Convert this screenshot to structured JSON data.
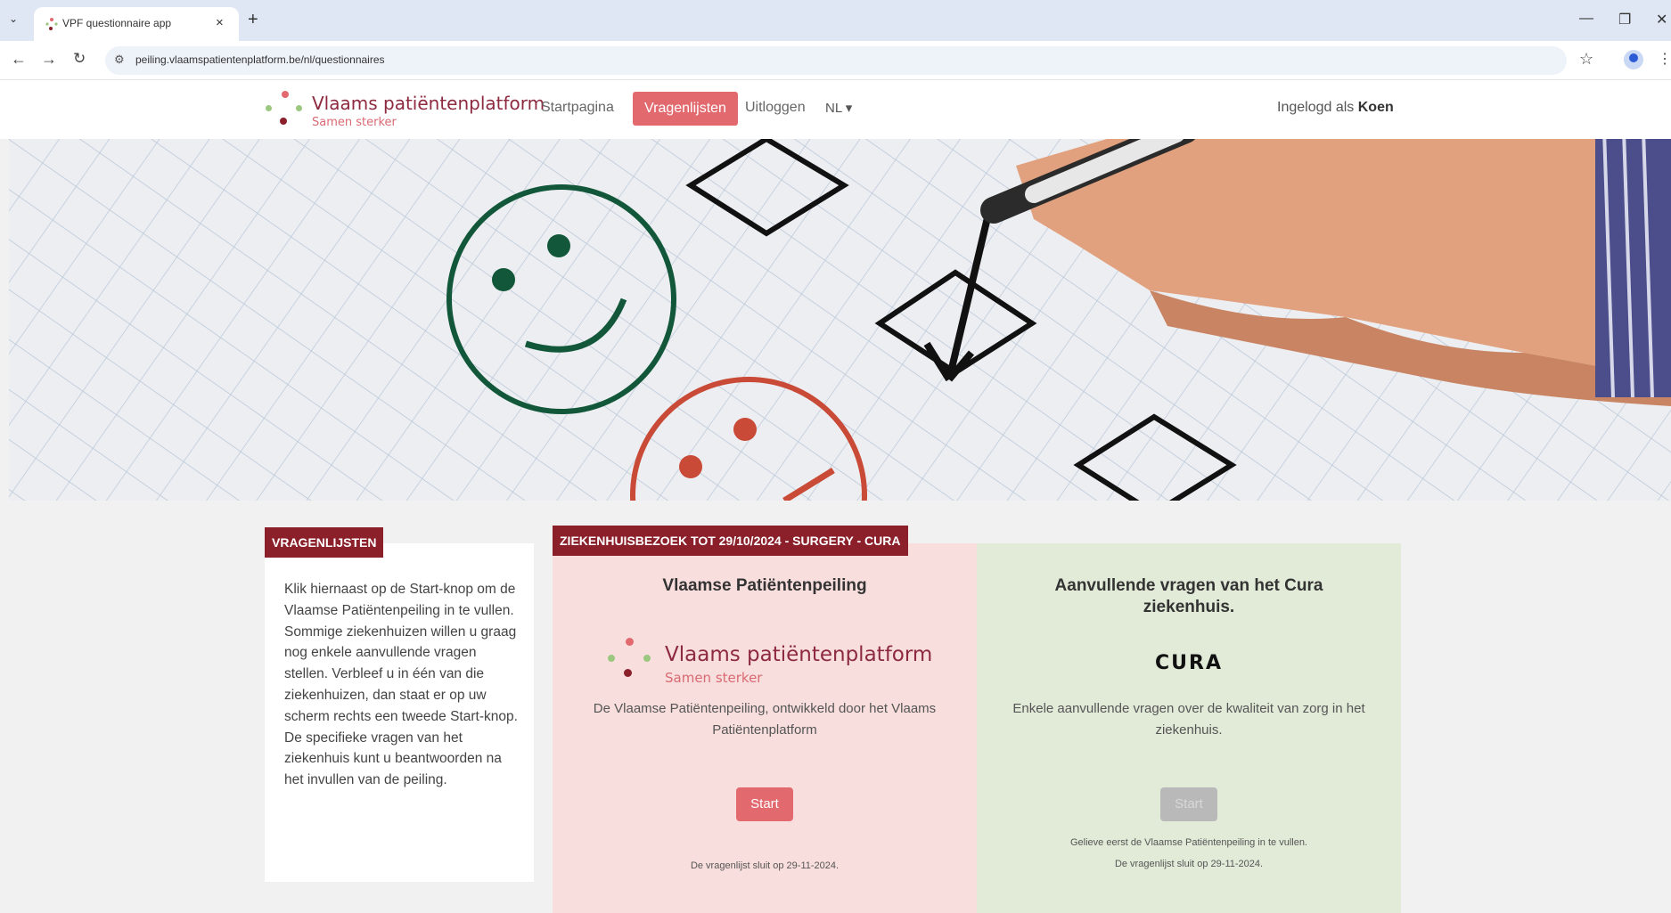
{
  "browser": {
    "tab_title": "VPF questionnaire app",
    "tab_close": "×",
    "new_tab": "+",
    "url": "peiling.vlaamspatientenplatform.be/nl/questionnaires"
  },
  "header": {
    "brand_title": "Vlaams patiëntenplatform",
    "brand_tagline": "Samen sterker",
    "nav": {
      "home": "Startpagina",
      "questionnaires": "Vragenlijsten",
      "logout": "Uitloggen",
      "language": "NL"
    },
    "logged_in_prefix": "Ingelogd als",
    "logged_in_user": "Koen"
  },
  "sidebar": {
    "tag": "VRAGENLIJSTEN",
    "text": "Klik hiernaast op de Start-knop om de Vlaamse Patiëntenpeiling in te vullen. Sommige ziekenhuizen willen u graag nog enkele aanvullende vragen stellen. Verbleef u in één van die ziekenhuizen, dan staat er op uw scherm rechts een tweede Start-knop. De specifieke vragen van het ziekenhuis kunt u beantwoorden na het invullen van de peiling."
  },
  "visit": {
    "tag": "ZIEKENHUISBEZOEK TOT 29/10/2024 - SURGERY - CURA",
    "card1": {
      "title": "Vlaamse Patiëntenpeiling",
      "logo_title": "Vlaams patiëntenplatform",
      "logo_tagline": "Samen sterker",
      "description": "De Vlaamse Patiëntenpeiling, ontwikkeld door het Vlaams Patiëntenplatform",
      "button": "Start",
      "note": "De vragenlijst sluit op 29-11-2024."
    },
    "card2": {
      "title": "Aanvullende vragen van het Cura ziekenhuis.",
      "logo": "CURA",
      "description": "Enkele aanvullende vragen over de kwaliteit van zorg in het ziekenhuis.",
      "button": "Start",
      "note1": "Gelieve eerst de Vlaamse Patiëntenpeiling in te vullen.",
      "note2": "De vragenlijst sluit op 29-11-2024."
    }
  },
  "colors": {
    "brand": "#8d2a40",
    "accent": "#e26a6f",
    "tag_bg": "#8b1f2a",
    "panel_red": "#f8dedd",
    "panel_green": "#e1ebd8",
    "disabled": "#b9b9b9"
  },
  "icons": {
    "tab_menu": "chevron-down-icon",
    "back": "arrow-left-icon",
    "forward": "arrow-right-icon",
    "reload": "reload-icon",
    "site_info": "tune-icon",
    "bookmark": "star-icon",
    "profile": "person-icon",
    "menu": "kebab-menu-icon"
  }
}
